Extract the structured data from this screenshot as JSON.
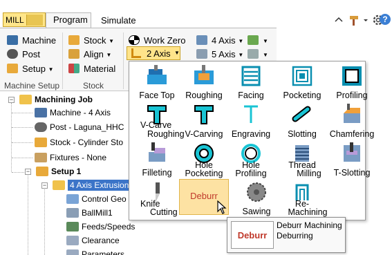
{
  "header": {
    "mill_label": "MILL",
    "tabs": [
      "Program",
      "Simulate"
    ]
  },
  "ribbon": {
    "col1": [
      "Machine",
      "Post",
      "Setup"
    ],
    "col2": [
      "Stock",
      "Align",
      "Material"
    ],
    "col3": [
      "Work Zero",
      "2 Axis"
    ],
    "col4": [
      "4 Axis",
      "5 Axis"
    ],
    "groups": [
      "Machine Setup",
      "Stock"
    ]
  },
  "tree": {
    "items": [
      "Machining Job",
      "Machine - 4 Axis",
      "Post - Laguna_HHC",
      "Stock - Cylinder Sto",
      "Fixtures - None",
      "Setup 1",
      "4 Axis Extrusion",
      "Control Geo",
      "BallMill1",
      "Feeds/Speeds",
      "Clearance",
      "Parameters"
    ]
  },
  "menu": {
    "tiles": [
      {
        "l1": "Face Top",
        "l2": ""
      },
      {
        "l1": "Roughing",
        "l2": ""
      },
      {
        "l1": "Facing",
        "l2": ""
      },
      {
        "l1": "Pocketing",
        "l2": ""
      },
      {
        "l1": "Profiling",
        "l2": ""
      },
      {
        "l1": "V-Carve",
        "l2": "Roughing"
      },
      {
        "l1": "V-Carving",
        "l2": ""
      },
      {
        "l1": "Engraving",
        "l2": ""
      },
      {
        "l1": "Slotting",
        "l2": ""
      },
      {
        "l1": "Chamfering",
        "l2": ""
      },
      {
        "l1": "Filleting",
        "l2": ""
      },
      {
        "l1": "Hole",
        "l2": "Pocketing"
      },
      {
        "l1": "Hole",
        "l2": "Profiling"
      },
      {
        "l1": "Thread",
        "l2": "Milling"
      },
      {
        "l1": "T-Slotting",
        "l2": ""
      },
      {
        "l1": "Knife",
        "l2": "Cutting"
      },
      {
        "l1": "Deburr",
        "l2": ""
      },
      {
        "l1": "Sawing",
        "l2": ""
      },
      {
        "l1": "Re-",
        "l2": "Machining"
      }
    ]
  },
  "tooltip": {
    "box": "Deburr",
    "title": "Deburr Machining",
    "desc": "Deburring"
  },
  "colors": {
    "accent": "#ffe48a",
    "deburr_red": "#c0392b"
  }
}
